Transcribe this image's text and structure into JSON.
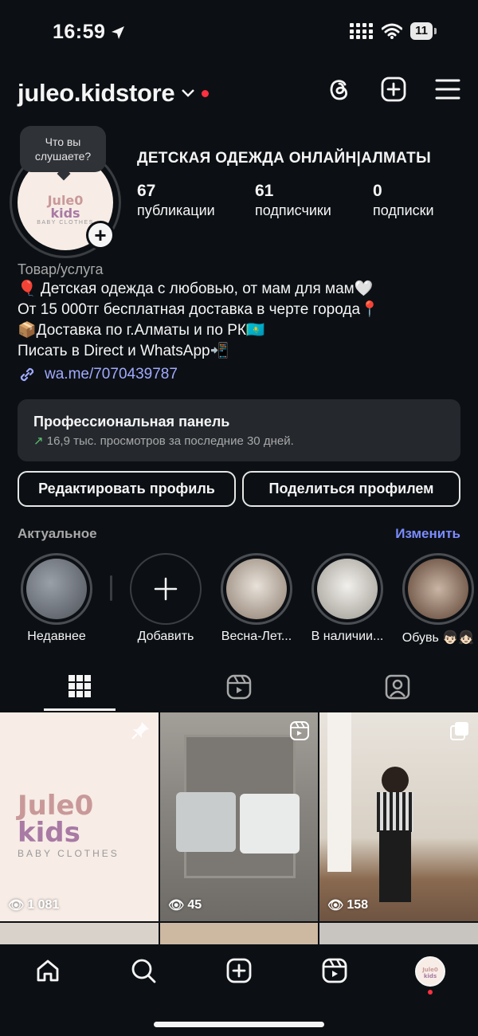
{
  "status": {
    "time": "16:59",
    "battery": "11"
  },
  "header": {
    "username": "juleo.kidstore"
  },
  "avatar": {
    "bubble_text": "Что вы слушаете?",
    "logo_line1": "Jule0",
    "logo_line2": "kids",
    "logo_tag": "BABY CLOTHES"
  },
  "profile": {
    "shop_title": "ДЕТСКАЯ ОДЕЖДА ОНЛАЙН|АЛМАТЫ",
    "stats": [
      {
        "value": "67",
        "label": "публикации"
      },
      {
        "value": "61",
        "label": "подписчики"
      },
      {
        "value": "0",
        "label": "подписки"
      }
    ],
    "category": "Товар/услуга",
    "bio_lines": [
      "🎈 Детская одежда с любовью, от мам для мам🤍",
      "От 15 000тг бесплатная доставка в черте города📍",
      "📦Доставка по г.Алматы и по РК🇰🇿",
      "Писать в Direct и WhatsApp📲"
    ],
    "link": "wa.me/7070439787"
  },
  "pro_panel": {
    "title": "Профессиональная панель",
    "arrow": "↗",
    "subtitle": "16,9 тыс. просмотров за последние 30 дней."
  },
  "buttons": {
    "edit": "Редактировать профиль",
    "share": "Поделиться профилем"
  },
  "highlights": {
    "heading": "Актуальное",
    "edit_label": "Изменить",
    "items": [
      {
        "label": "Недавнее",
        "color": "#7a7f86"
      },
      {
        "label": "Добавить"
      },
      {
        "label": "Весна-Лет...",
        "color": "#b8a99a"
      },
      {
        "label": "В наличии...",
        "color": "#cfcac3"
      },
      {
        "label": "Обувь 👦🏻👧🏻",
        "color": "#6b4e3d"
      }
    ]
  },
  "grid": {
    "tiles": [
      {
        "views": "1 081",
        "pinned": true,
        "bg": "#f7ece6"
      },
      {
        "views": "45",
        "bg": "#8a8782"
      },
      {
        "views": "158",
        "bg": "#b59a7e"
      }
    ]
  }
}
